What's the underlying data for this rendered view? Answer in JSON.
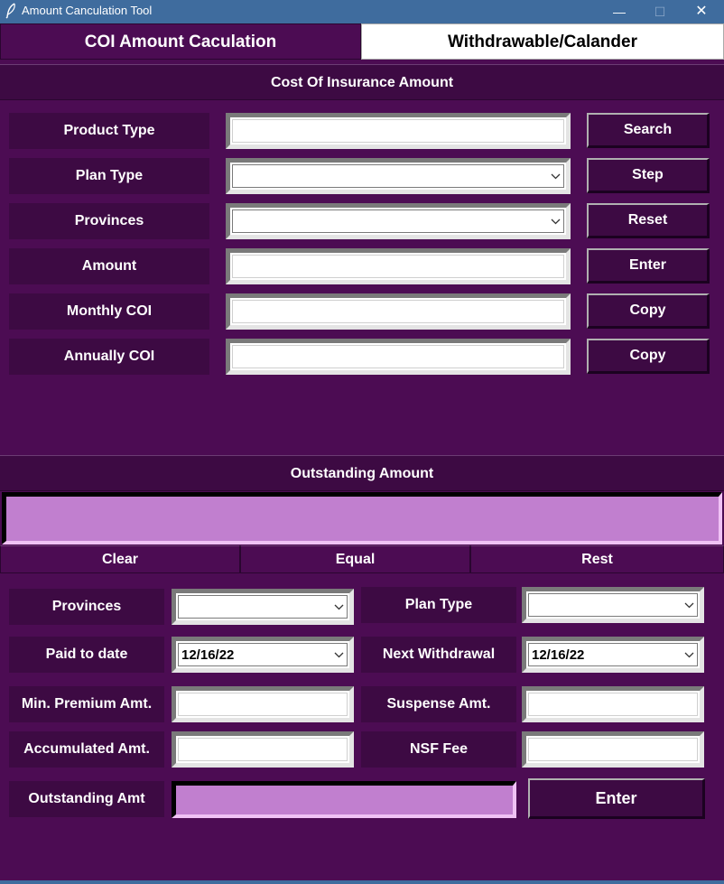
{
  "window": {
    "title": "Amount Canculation Tool",
    "minimize_glyph": "—",
    "maximize_glyph": "☐",
    "close_glyph": "✕"
  },
  "tabs": [
    {
      "label": "COI Amount Caculation",
      "active": true
    },
    {
      "label": "Withdrawable/Calander",
      "active": false
    }
  ],
  "coi_section": {
    "header": "Cost Of Insurance Amount",
    "rows": [
      {
        "label": "Product Type",
        "value": "",
        "widget": "entry",
        "button": "Search"
      },
      {
        "label": "Plan Type",
        "value": "",
        "widget": "combobox",
        "button": "Step"
      },
      {
        "label": "Provinces",
        "value": "",
        "widget": "combobox",
        "button": "Reset"
      },
      {
        "label": "Amount",
        "value": "",
        "widget": "entry",
        "button": "Enter"
      },
      {
        "label": "Monthly COI",
        "value": "",
        "widget": "entry",
        "button": "Copy"
      },
      {
        "label": "Annually COI",
        "value": "",
        "widget": "entry",
        "button": "Copy"
      }
    ]
  },
  "outstanding_section": {
    "header": "Outstanding Amount",
    "display_value": "",
    "calc_buttons": [
      "Clear",
      "Equal",
      "Rest"
    ],
    "left_fields": [
      {
        "label": "Provinces",
        "value": "",
        "widget": "combobox"
      },
      {
        "label": "Paid to date",
        "value": "12/16/22",
        "widget": "combobox"
      },
      {
        "label": "Min. Premium Amt.",
        "value": "",
        "widget": "entry"
      },
      {
        "label": "Accumulated Amt.",
        "value": "",
        "widget": "entry"
      }
    ],
    "right_fields": [
      {
        "label": "Plan Type",
        "value": "",
        "widget": "combobox"
      },
      {
        "label": "Next Withdrawal",
        "value": "12/16/22",
        "widget": "combobox"
      },
      {
        "label": "Suspense Amt.",
        "value": "",
        "widget": "entry"
      },
      {
        "label": "NSF Fee",
        "value": "",
        "widget": "entry"
      }
    ],
    "outstanding_label": "Outstanding Amt",
    "outstanding_value": "",
    "enter_button": "Enter"
  },
  "colors": {
    "background": "#4c0c53",
    "panel": "#3d0a43",
    "pink_field": "#c17fcf",
    "titlebar": "#3f6c9e"
  },
  "icons": [
    "feather-icon",
    "minimize-icon",
    "maximize-icon",
    "close-icon",
    "chevron-down-icon"
  ]
}
